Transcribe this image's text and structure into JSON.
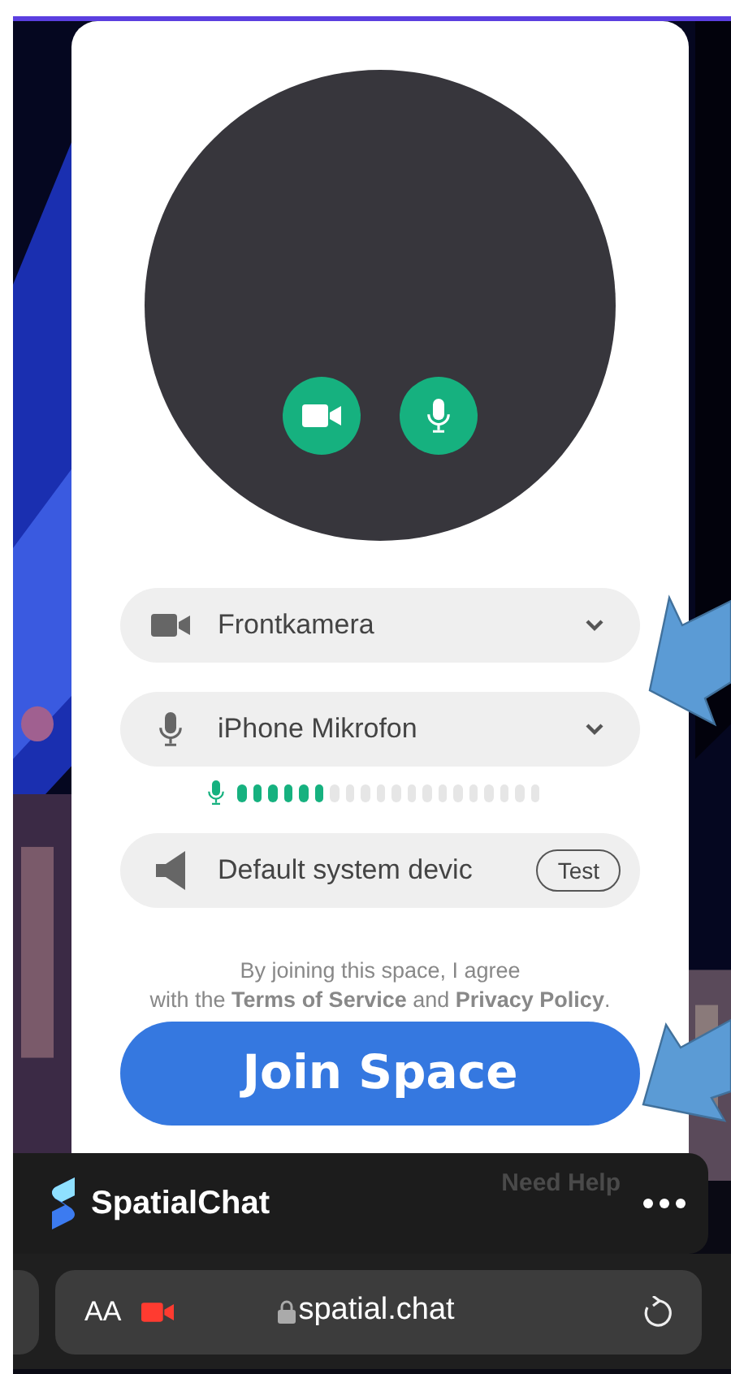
{
  "video_preview": {
    "toggles": [
      {
        "kind": "camera",
        "on": true
      },
      {
        "kind": "microphone",
        "on": true
      }
    ]
  },
  "devices": [
    {
      "kind": "camera",
      "label": "Frontkamera"
    },
    {
      "kind": "microphone",
      "label": "iPhone Mikrofon"
    },
    {
      "kind": "speaker",
      "label": "Default system devic",
      "test_button": "Test"
    }
  ],
  "mic_level": {
    "level": 0.3
  },
  "consent": "By joining this space, I agree\nwith the **Terms of Service** and **Privacy Policy**.",
  "join_button": "Join Space",
  "app_bar": {
    "brand": "SpatialChat",
    "help": "Need Help"
  },
  "browser_bar": {
    "text_size": "AA",
    "url": "spatial.chat"
  }
}
